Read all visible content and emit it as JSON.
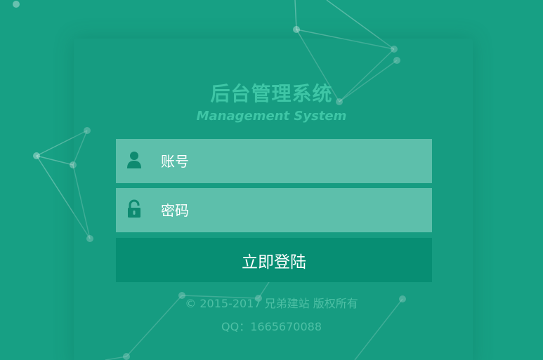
{
  "header": {
    "title": "后台管理系统",
    "subtitle": "Management System"
  },
  "form": {
    "account_placeholder": "账号",
    "password_placeholder": "密码",
    "submit_label": "立即登陆"
  },
  "footer": {
    "copyright": "© 2015-2017 兄弟建站 版权所有",
    "qq_label": "QQ：",
    "qq_number": "1665670088"
  },
  "icons": {
    "account": "user-icon",
    "password": "lock-icon"
  },
  "colors": {
    "background": "#17a084",
    "input_background": "#5dbfab",
    "button_background": "#078e73",
    "icon": "#0e8a70",
    "title_text": "#3ec6a6",
    "footer_text": "#4ec0a5"
  }
}
